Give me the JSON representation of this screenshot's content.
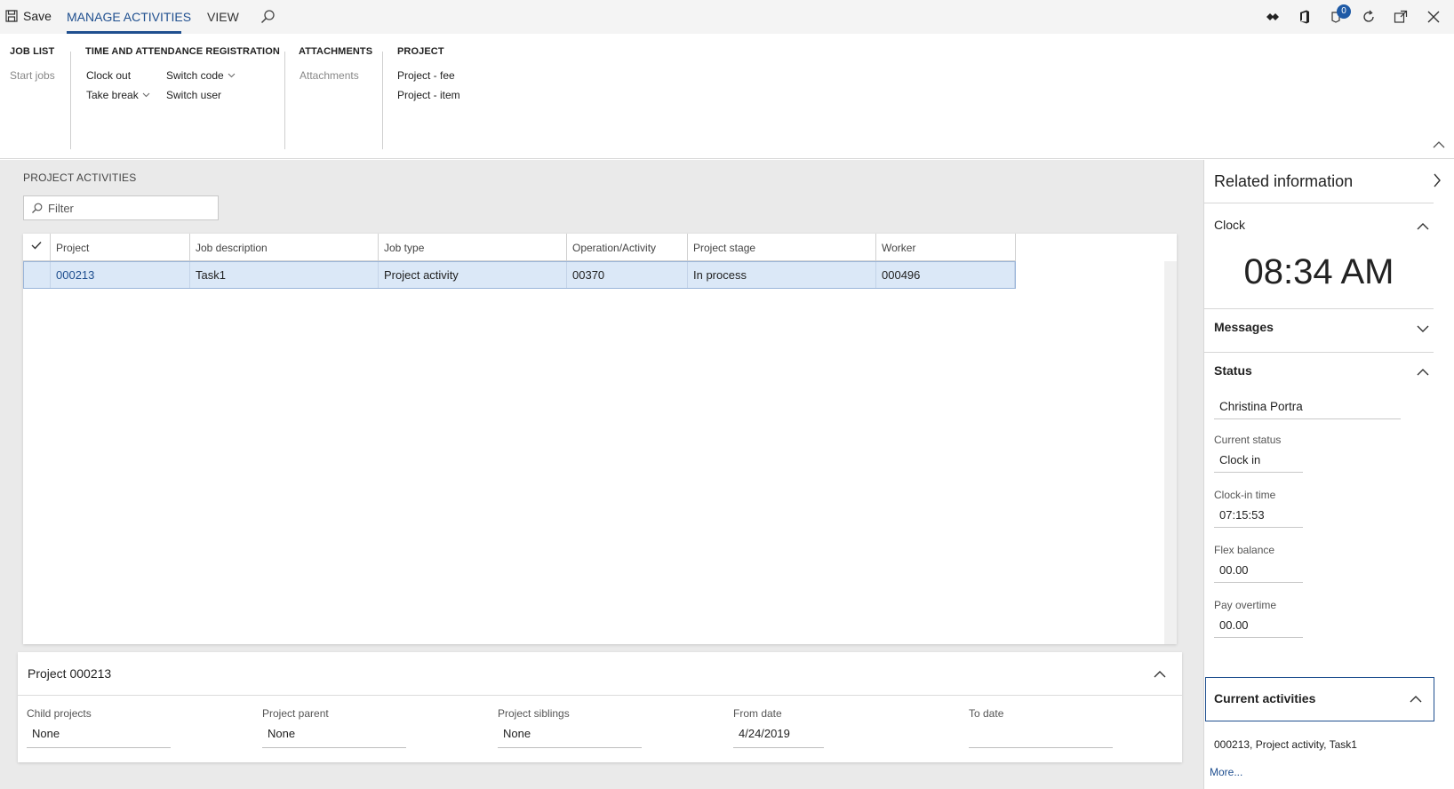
{
  "toolbar": {
    "save": "Save",
    "tabs": [
      "MANAGE ACTIVITIES",
      "VIEW"
    ],
    "notification_count": "0"
  },
  "ribbon": {
    "groups": [
      {
        "heading": "JOB LIST",
        "items": [
          "Start jobs"
        ]
      },
      {
        "heading": "TIME AND ATTENDANCE REGISTRATION",
        "items": [
          "Clock out",
          "Take break",
          "Switch code",
          "Switch user"
        ]
      },
      {
        "heading": "ATTACHMENTS",
        "items": [
          "Attachments"
        ]
      },
      {
        "heading": "PROJECT",
        "items": [
          "Project - fee",
          "Project - item"
        ]
      }
    ]
  },
  "main": {
    "section_label": "PROJECT ACTIVITIES",
    "filter_placeholder": "Filter",
    "grid": {
      "columns": [
        "Project",
        "Job description",
        "Job type",
        "Operation/Activity",
        "Project stage",
        "Worker"
      ],
      "rows": [
        [
          "000213",
          "Task1",
          "Project activity",
          "00370",
          "In process",
          "000496"
        ]
      ]
    },
    "project_card": {
      "title": "Project 000213",
      "fields": [
        {
          "label": "Child projects",
          "value": "None"
        },
        {
          "label": "Project parent",
          "value": "None"
        },
        {
          "label": "Project siblings",
          "value": "None"
        },
        {
          "label": "From date",
          "value": "4/24/2019"
        },
        {
          "label": "To date",
          "value": ""
        }
      ]
    }
  },
  "related": {
    "title": "Related information",
    "clock": {
      "heading": "Clock",
      "time": "08:34 AM"
    },
    "messages": {
      "heading": "Messages"
    },
    "status": {
      "heading": "Status",
      "name": "Christina Portra",
      "fields": [
        {
          "label": "Current status",
          "value": "Clock in"
        },
        {
          "label": "Clock-in time",
          "value": "07:15:53"
        },
        {
          "label": "Flex balance",
          "value": "00.00"
        },
        {
          "label": "Pay overtime",
          "value": "00.00"
        }
      ]
    },
    "current_activities": {
      "heading": "Current activities",
      "text": "000213, Project activity, Task1",
      "more": "More..."
    }
  },
  "colors": {
    "accent": "#1f4f8f",
    "selected_row": "#dbe8f7",
    "workspace": "#eaeaea"
  }
}
